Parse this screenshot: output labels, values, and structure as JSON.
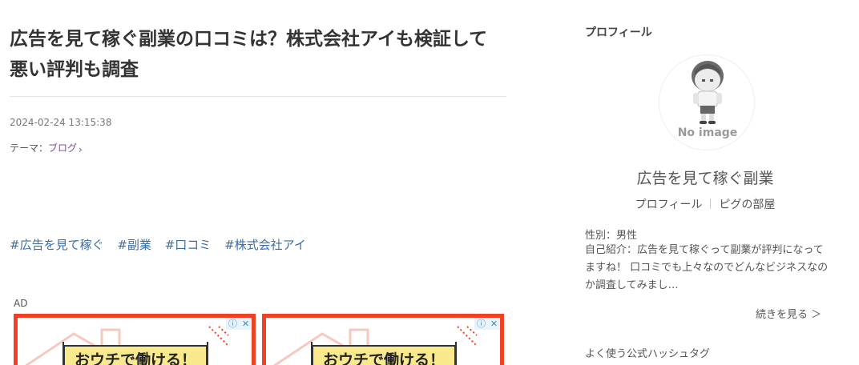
{
  "article": {
    "title": "広告を見て稼ぐ副業の口コミは？株式会社アイも検証して悪い評判も調査",
    "datetime": "2024-02-24 13:15:38",
    "theme_label": "テーマ：",
    "theme_value": "ブログ",
    "hashtags": [
      "#広告を見て稼ぐ",
      "#副業",
      "#口コミ",
      "#株式会社アイ"
    ],
    "ad_label": "AD",
    "ads": [
      {
        "headline": "おウチで働ける！",
        "choice_info": "ⓘ",
        "choice_close": "✕"
      },
      {
        "headline": "おウチで働ける！",
        "choice_info": "ⓘ",
        "choice_close": "✕"
      }
    ]
  },
  "sidebar": {
    "heading": "プロフィール",
    "avatar_text": "No image",
    "nickname": "広告を見て稼ぐ副業",
    "profile_link": "プロフィール",
    "room_link": "ピグの部屋",
    "gender": "性別：男性",
    "intro": "自己紹介：広告を見て稼ぐって副業が評判になってますね！ 口コミでも上々なのでどんなビジネスなのか調査してみまし…",
    "more_link": "続きを見る ＞",
    "hashtag_heading": "よく使う公式ハッシュタグ"
  },
  "colors": {
    "ad_border": "#ef4123",
    "ad_yellow": "#f7e98c",
    "hashtag": "#3a6ea5",
    "theme_link": "#7b4e9a"
  }
}
